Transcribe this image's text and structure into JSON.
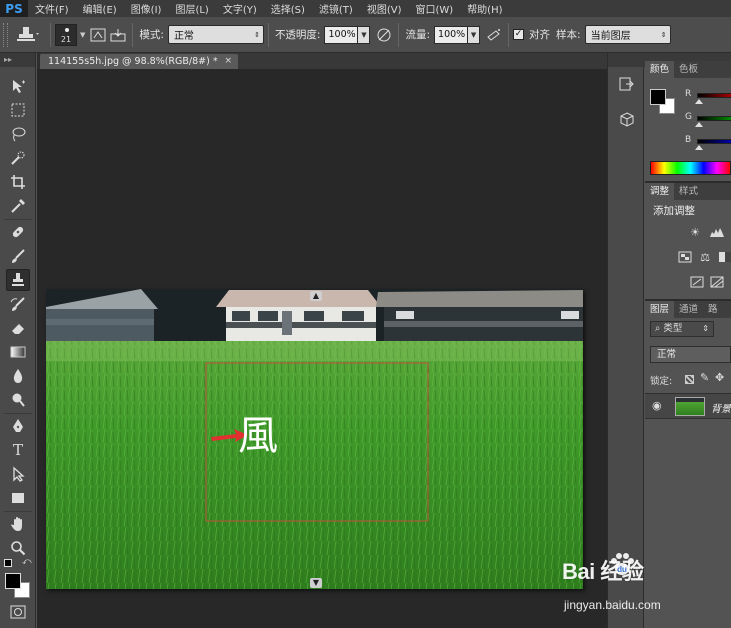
{
  "app": {
    "logo": "PS"
  },
  "menu": [
    "文件(F)",
    "编辑(E)",
    "图像(I)",
    "图层(L)",
    "文字(Y)",
    "选择(S)",
    "滤镜(T)",
    "视图(V)",
    "窗口(W)",
    "帮助(H)"
  ],
  "options": {
    "brush_size": "21",
    "mode_label": "模式:",
    "mode_value": "正常",
    "opacity_label": "不透明度:",
    "opacity_value": "100%",
    "flow_label": "流量:",
    "flow_value": "100%",
    "align_label": "对齐",
    "align_checked": true,
    "sample_label": "样本:",
    "sample_value": "当前图层"
  },
  "toolbox": {
    "header": "▸▸"
  },
  "document": {
    "tab_title": "114155s5h.jpg @ 98.8%(RGB/8#) *",
    "close_glyph": "×",
    "overlay_char": "風",
    "colors": {
      "grass": "#3f9a2a",
      "selection": "#c0513a",
      "arrow": "#e03030"
    }
  },
  "panels": {
    "color_tabs": [
      "颜色",
      "色板"
    ],
    "sliders": [
      {
        "label": "R",
        "color": "#c00000"
      },
      {
        "label": "G",
        "color": "#00a000"
      },
      {
        "label": "B",
        "color": "#0000c0"
      }
    ],
    "adjust_tabs": [
      "调整",
      "样式"
    ],
    "adjust_title": "添加调整",
    "layers_tabs": [
      "图层",
      "通道",
      "路"
    ],
    "layer_kind": "类型",
    "blend_mode": "正常",
    "lock_label": "锁定:",
    "layer_name": "背景"
  },
  "watermark": {
    "logo_text": "Bai 经验",
    "url": "jingyan.baidu.com"
  }
}
